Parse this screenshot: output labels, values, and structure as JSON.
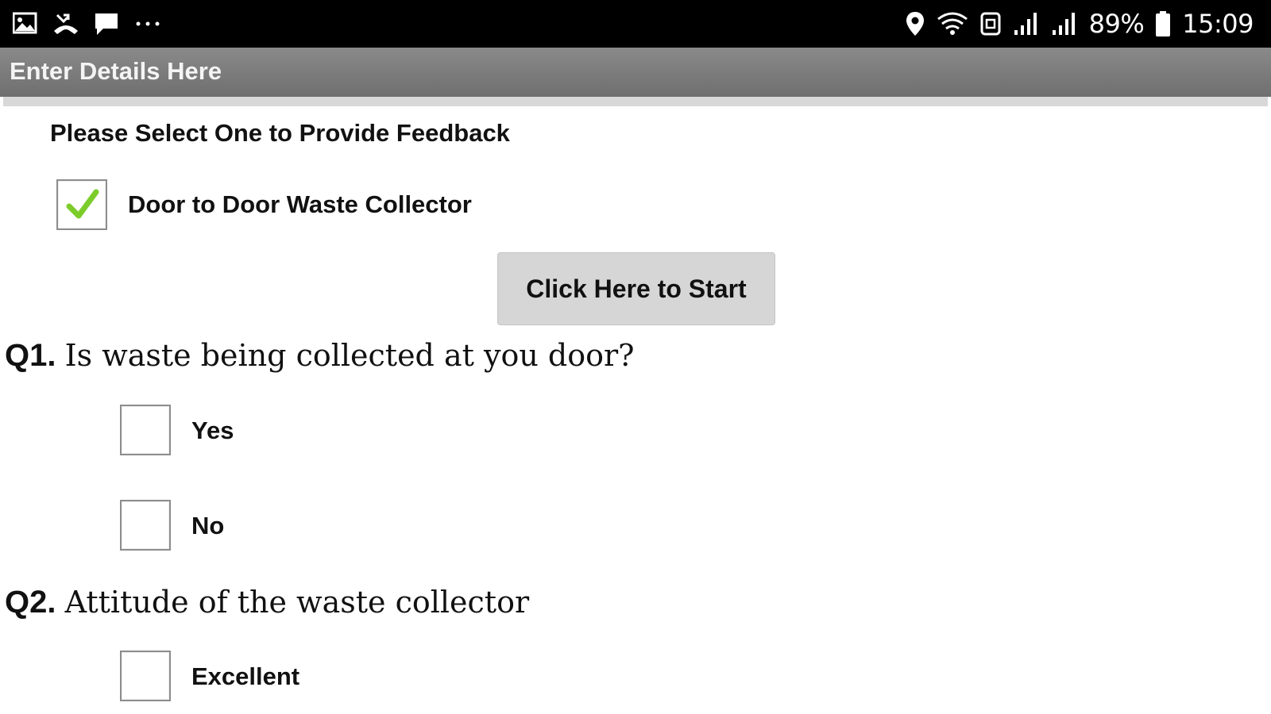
{
  "status_bar": {
    "left_icons": [
      "gallery-icon",
      "missed-call-icon",
      "message-icon",
      "more-dots-icon"
    ],
    "battery_percent": "89%",
    "time": "15:09",
    "right_icons": [
      "location-icon",
      "wifi-icon",
      "signal-icon",
      "signal-icon",
      "battery-icon"
    ]
  },
  "header": {
    "title": "Enter Details Here"
  },
  "form": {
    "prompt": "Please Select One to Provide Feedback",
    "category_option": {
      "label": "Door to Door Waste Collector",
      "checked": true
    },
    "start_button": "Click Here to Start",
    "questions": [
      {
        "number": "Q1.",
        "text": "Is waste being collected at you door?",
        "options": [
          {
            "label": "Yes",
            "checked": false
          },
          {
            "label": "No",
            "checked": false
          }
        ]
      },
      {
        "number": "Q2.",
        "text": "Attitude of the waste collector",
        "options": [
          {
            "label": "Excellent",
            "checked": false
          }
        ]
      }
    ]
  },
  "colors": {
    "status_bar_bg": "#000000",
    "title_bar_bg": "#7a7a7a",
    "check_green": "#7ccd2a",
    "button_bg": "#d6d6d6"
  }
}
